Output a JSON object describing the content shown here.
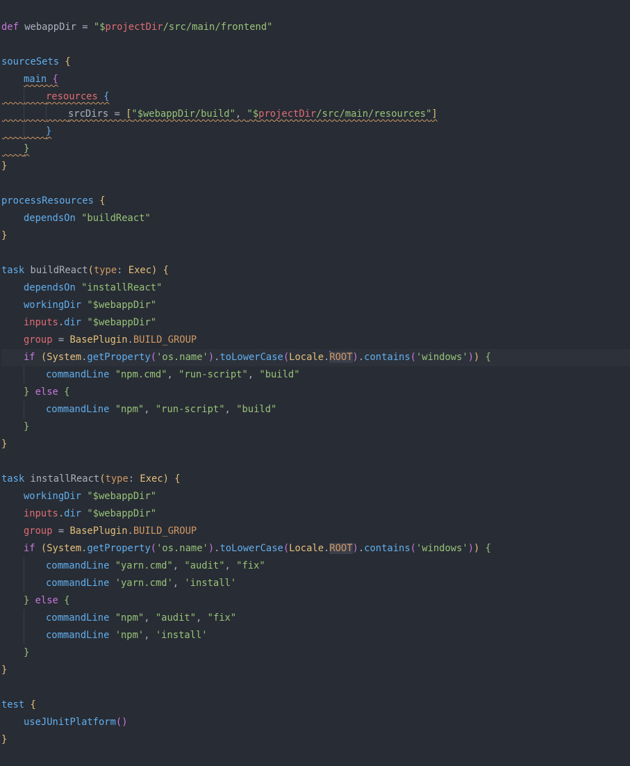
{
  "editor": {
    "language": "groovy",
    "lines": [
      {
        "indent": 0,
        "tokens": [
          {
            "t": "def",
            "c": "kw"
          },
          {
            "t": " webappDir = ",
            "c": "id"
          },
          {
            "t": "\"$",
            "c": "str"
          },
          {
            "t": "projectDir",
            "c": "var"
          },
          {
            "t": "/src/main/frontend\"",
            "c": "str"
          }
        ]
      },
      {
        "indent": 0,
        "tokens": []
      },
      {
        "indent": 0,
        "tokens": [
          {
            "t": "sourceSets ",
            "c": "task"
          },
          {
            "t": "{",
            "c": "p1"
          }
        ]
      },
      {
        "indent": 1,
        "tokens": [
          {
            "t": "main ",
            "c": "task",
            "squig": true
          },
          {
            "t": "{",
            "c": "p2",
            "squig": true
          }
        ]
      },
      {
        "indent": 2,
        "squigIndent": true,
        "tokens": [
          {
            "t": "resources ",
            "c": "prop",
            "squig": true
          },
          {
            "t": "{",
            "c": "p3",
            "squig": true
          }
        ]
      },
      {
        "indent": 3,
        "squigIndent": true,
        "tokens": [
          {
            "t": "srcDirs = ",
            "c": "id",
            "squig": true
          },
          {
            "t": "[",
            "c": "p1",
            "squig": true
          },
          {
            "t": "\"$webappDir/build\"",
            "c": "str",
            "squig": true
          },
          {
            "t": ", ",
            "c": "id",
            "squig": true
          },
          {
            "t": "\"$",
            "c": "str",
            "squig": true
          },
          {
            "t": "projectDir",
            "c": "var",
            "squig": true
          },
          {
            "t": "/src/main/resources\"",
            "c": "str",
            "squig": true
          },
          {
            "t": "]",
            "c": "p1",
            "squig": true
          }
        ]
      },
      {
        "indent": 2,
        "squigIndent": true,
        "tokens": [
          {
            "t": "}",
            "c": "p3",
            "squig": true
          }
        ]
      },
      {
        "indent": 1,
        "squigIndent": true,
        "tokens": [
          {
            "t": "}",
            "c": "p4",
            "squig": true
          }
        ]
      },
      {
        "indent": 0,
        "tokens": [
          {
            "t": "}",
            "c": "p1"
          }
        ]
      },
      {
        "indent": 0,
        "tokens": []
      },
      {
        "indent": 0,
        "tokens": [
          {
            "t": "processResources ",
            "c": "task"
          },
          {
            "t": "{",
            "c": "p1"
          }
        ]
      },
      {
        "indent": 1,
        "tokens": [
          {
            "t": "dependsOn ",
            "c": "fn"
          },
          {
            "t": "\"buildReact\"",
            "c": "str"
          }
        ]
      },
      {
        "indent": 0,
        "tokens": [
          {
            "t": "}",
            "c": "p1"
          }
        ]
      },
      {
        "indent": 0,
        "tokens": []
      },
      {
        "indent": 0,
        "tokens": [
          {
            "t": "task ",
            "c": "task"
          },
          {
            "t": "buildReact",
            "c": "id"
          },
          {
            "t": "(",
            "c": "p1"
          },
          {
            "t": "type",
            "c": "const"
          },
          {
            "t": ": ",
            "c": "id"
          },
          {
            "t": "Exec",
            "c": "type"
          },
          {
            "t": ") ",
            "c": "p1"
          },
          {
            "t": "{",
            "c": "p1"
          }
        ]
      },
      {
        "indent": 1,
        "tokens": [
          {
            "t": "dependsOn ",
            "c": "fn"
          },
          {
            "t": "\"installReact\"",
            "c": "str"
          }
        ]
      },
      {
        "indent": 1,
        "tokens": [
          {
            "t": "workingDir ",
            "c": "fn"
          },
          {
            "t": "\"$webappDir\"",
            "c": "str"
          }
        ]
      },
      {
        "indent": 1,
        "tokens": [
          {
            "t": "inputs",
            "c": "prop"
          },
          {
            "t": ".",
            "c": "id"
          },
          {
            "t": "dir ",
            "c": "fn"
          },
          {
            "t": "\"$webappDir\"",
            "c": "str"
          }
        ]
      },
      {
        "indent": 1,
        "tokens": [
          {
            "t": "group",
            "c": "prop"
          },
          {
            "t": " = ",
            "c": "id"
          },
          {
            "t": "BasePlugin",
            "c": "type"
          },
          {
            "t": ".",
            "c": "id"
          },
          {
            "t": "BUILD_GROUP",
            "c": "const"
          }
        ]
      },
      {
        "indent": 1,
        "current": true,
        "tokens": [
          {
            "t": "if ",
            "c": "kw"
          },
          {
            "t": "(",
            "c": "p1"
          },
          {
            "t": "System",
            "c": "type"
          },
          {
            "t": ".",
            "c": "id"
          },
          {
            "t": "getProperty",
            "c": "fn"
          },
          {
            "t": "(",
            "c": "p2"
          },
          {
            "t": "'os.name'",
            "c": "str"
          },
          {
            "t": ")",
            "c": "p2"
          },
          {
            "t": ".",
            "c": "id"
          },
          {
            "t": "toLowerCase",
            "c": "fn"
          },
          {
            "t": "(",
            "c": "p2"
          },
          {
            "t": "Locale",
            "c": "type"
          },
          {
            "t": ".",
            "c": "id"
          },
          {
            "t": "CARET",
            "c": "caret"
          },
          {
            "t": "ROOT",
            "c": "const",
            "hl": true
          },
          {
            "t": ")",
            "c": "p2"
          },
          {
            "t": ".",
            "c": "id"
          },
          {
            "t": "contains",
            "c": "fn"
          },
          {
            "t": "(",
            "c": "p2"
          },
          {
            "t": "'windows'",
            "c": "str"
          },
          {
            "t": ")",
            "c": "p2"
          },
          {
            "t": ") ",
            "c": "p1"
          },
          {
            "t": "{",
            "c": "p4"
          }
        ]
      },
      {
        "indent": 2,
        "tokens": [
          {
            "t": "commandLine ",
            "c": "fn"
          },
          {
            "t": "\"npm.cmd\"",
            "c": "str"
          },
          {
            "t": ", ",
            "c": "id"
          },
          {
            "t": "\"run-script\"",
            "c": "str"
          },
          {
            "t": ", ",
            "c": "id"
          },
          {
            "t": "\"build\"",
            "c": "str"
          }
        ]
      },
      {
        "indent": 1,
        "tokens": [
          {
            "t": "} ",
            "c": "p4"
          },
          {
            "t": "else ",
            "c": "kw"
          },
          {
            "t": "{",
            "c": "p4"
          }
        ]
      },
      {
        "indent": 2,
        "tokens": [
          {
            "t": "commandLine ",
            "c": "fn"
          },
          {
            "t": "\"npm\"",
            "c": "str"
          },
          {
            "t": ", ",
            "c": "id"
          },
          {
            "t": "\"run-script\"",
            "c": "str"
          },
          {
            "t": ", ",
            "c": "id"
          },
          {
            "t": "\"build\"",
            "c": "str"
          }
        ]
      },
      {
        "indent": 1,
        "tokens": [
          {
            "t": "}",
            "c": "p4"
          }
        ]
      },
      {
        "indent": 0,
        "tokens": [
          {
            "t": "}",
            "c": "p1"
          }
        ]
      },
      {
        "indent": 0,
        "tokens": []
      },
      {
        "indent": 0,
        "tokens": [
          {
            "t": "task ",
            "c": "task"
          },
          {
            "t": "installReact",
            "c": "id"
          },
          {
            "t": "(",
            "c": "p1"
          },
          {
            "t": "type",
            "c": "const"
          },
          {
            "t": ": ",
            "c": "id"
          },
          {
            "t": "Exec",
            "c": "type"
          },
          {
            "t": ") ",
            "c": "p1"
          },
          {
            "t": "{",
            "c": "p1"
          }
        ]
      },
      {
        "indent": 1,
        "tokens": [
          {
            "t": "workingDir ",
            "c": "fn"
          },
          {
            "t": "\"$webappDir\"",
            "c": "str"
          }
        ]
      },
      {
        "indent": 1,
        "tokens": [
          {
            "t": "inputs",
            "c": "prop"
          },
          {
            "t": ".",
            "c": "id"
          },
          {
            "t": "dir ",
            "c": "fn"
          },
          {
            "t": "\"$webappDir\"",
            "c": "str"
          }
        ]
      },
      {
        "indent": 1,
        "tokens": [
          {
            "t": "group",
            "c": "prop"
          },
          {
            "t": " = ",
            "c": "id"
          },
          {
            "t": "BasePlugin",
            "c": "type"
          },
          {
            "t": ".",
            "c": "id"
          },
          {
            "t": "BUILD_GROUP",
            "c": "const"
          }
        ]
      },
      {
        "indent": 1,
        "tokens": [
          {
            "t": "if ",
            "c": "kw"
          },
          {
            "t": "(",
            "c": "p1"
          },
          {
            "t": "System",
            "c": "type"
          },
          {
            "t": ".",
            "c": "id"
          },
          {
            "t": "getProperty",
            "c": "fn"
          },
          {
            "t": "(",
            "c": "p2"
          },
          {
            "t": "'os.name'",
            "c": "str"
          },
          {
            "t": ")",
            "c": "p2"
          },
          {
            "t": ".",
            "c": "id"
          },
          {
            "t": "toLowerCase",
            "c": "fn"
          },
          {
            "t": "(",
            "c": "p2"
          },
          {
            "t": "Locale",
            "c": "type"
          },
          {
            "t": ".",
            "c": "id"
          },
          {
            "t": "ROOT",
            "c": "const",
            "hl": true
          },
          {
            "t": ")",
            "c": "p2"
          },
          {
            "t": ".",
            "c": "id"
          },
          {
            "t": "contains",
            "c": "fn"
          },
          {
            "t": "(",
            "c": "p2"
          },
          {
            "t": "'windows'",
            "c": "str"
          },
          {
            "t": ")",
            "c": "p2"
          },
          {
            "t": ") ",
            "c": "p1"
          },
          {
            "t": "{",
            "c": "p4"
          }
        ]
      },
      {
        "indent": 2,
        "tokens": [
          {
            "t": "commandLine ",
            "c": "fn"
          },
          {
            "t": "\"yarn.cmd\"",
            "c": "str"
          },
          {
            "t": ", ",
            "c": "id"
          },
          {
            "t": "\"audit\"",
            "c": "str"
          },
          {
            "t": ", ",
            "c": "id"
          },
          {
            "t": "\"fix\"",
            "c": "str"
          }
        ]
      },
      {
        "indent": 2,
        "tokens": [
          {
            "t": "commandLine ",
            "c": "fn"
          },
          {
            "t": "'yarn.cmd'",
            "c": "str"
          },
          {
            "t": ", ",
            "c": "id"
          },
          {
            "t": "'install'",
            "c": "str"
          }
        ]
      },
      {
        "indent": 1,
        "tokens": [
          {
            "t": "} ",
            "c": "p4"
          },
          {
            "t": "else ",
            "c": "kw"
          },
          {
            "t": "{",
            "c": "p4"
          }
        ]
      },
      {
        "indent": 2,
        "tokens": [
          {
            "t": "commandLine ",
            "c": "fn"
          },
          {
            "t": "\"npm\"",
            "c": "str"
          },
          {
            "t": ", ",
            "c": "id"
          },
          {
            "t": "\"audit\"",
            "c": "str"
          },
          {
            "t": ", ",
            "c": "id"
          },
          {
            "t": "\"fix\"",
            "c": "str"
          }
        ]
      },
      {
        "indent": 2,
        "tokens": [
          {
            "t": "commandLine ",
            "c": "fn"
          },
          {
            "t": "'npm'",
            "c": "str"
          },
          {
            "t": ", ",
            "c": "id"
          },
          {
            "t": "'install'",
            "c": "str"
          }
        ]
      },
      {
        "indent": 1,
        "tokens": [
          {
            "t": "}",
            "c": "p4"
          }
        ]
      },
      {
        "indent": 0,
        "tokens": [
          {
            "t": "}",
            "c": "p1"
          }
        ]
      },
      {
        "indent": 0,
        "tokens": []
      },
      {
        "indent": 0,
        "tokens": [
          {
            "t": "test ",
            "c": "task"
          },
          {
            "t": "{",
            "c": "p1"
          }
        ]
      },
      {
        "indent": 1,
        "tokens": [
          {
            "t": "useJUnitPlatform",
            "c": "fn"
          },
          {
            "t": "()",
            "c": "p2"
          }
        ]
      },
      {
        "indent": 0,
        "tokens": [
          {
            "t": "}",
            "c": "p1"
          }
        ]
      }
    ]
  }
}
